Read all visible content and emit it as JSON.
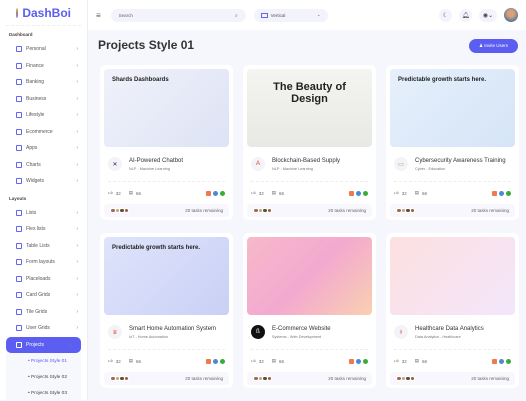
{
  "brand": "DashBoi",
  "sidebar": {
    "dashboard_label": "Dashboard",
    "layouts_label": "Layouts",
    "dashboard_items": [
      "Personal",
      "Finance",
      "Banking",
      "Business",
      "Lifestyle",
      "Ecommerce",
      "Apps",
      "Charts",
      "Widgets"
    ],
    "layout_items": [
      "Lists",
      "Flex lists",
      "Table Lists",
      "Form layouts",
      "Placeloads",
      "Card Grids",
      "Tile Grids",
      "User Grids"
    ],
    "active": "Projects",
    "sub_items": [
      "Projects Style 01",
      "Projects Style 02",
      "Projects Style 03"
    ]
  },
  "header": {
    "search_placeholder": "Search",
    "layout_select": "Vertical"
  },
  "page": {
    "title": "Projects Style 01",
    "invite_label": "Invite Users"
  },
  "cards": [
    {
      "title": "AI-Powered Chatbot",
      "category": "NLP - Machine Learning",
      "likes": "32",
      "comments": "66",
      "tasks": "20 tasks remaining",
      "image_text": "Shards Dashboards",
      "bg": "#eef0f8"
    },
    {
      "title": "Blockchain-Based Supply",
      "category": "NLP - Machine Learning",
      "likes": "32",
      "comments": "66",
      "tasks": "20 tasks remaining",
      "image_text": "The Beauty of Design",
      "bg": "#f3f3f1"
    },
    {
      "title": "Cybersecurity Awareness Training",
      "category": "Cyber - Education",
      "likes": "32",
      "comments": "66",
      "tasks": "20 tasks remaining",
      "image_text": "Predictable growth starts here.",
      "bg": "#eaf2fb"
    },
    {
      "title": "Smart Home Automation System",
      "category": "IoT - Home Automation",
      "likes": "32",
      "comments": "66",
      "tasks": "20 tasks remaining",
      "image_text": "Predictable growth starts here.",
      "bg": "#e6eafb"
    },
    {
      "title": "E-Commerce Website",
      "category": "Systems - Web Development",
      "likes": "32",
      "comments": "66",
      "tasks": "20 tasks remaining",
      "image_text": "",
      "bg": "#f7c6d3"
    },
    {
      "title": "Healthcare Data Analytics",
      "category": "Data Analytics - Healthcare",
      "likes": "32",
      "comments": "66",
      "tasks": "20 tasks remaining",
      "image_text": "",
      "bg": "#fbe3e3"
    }
  ]
}
